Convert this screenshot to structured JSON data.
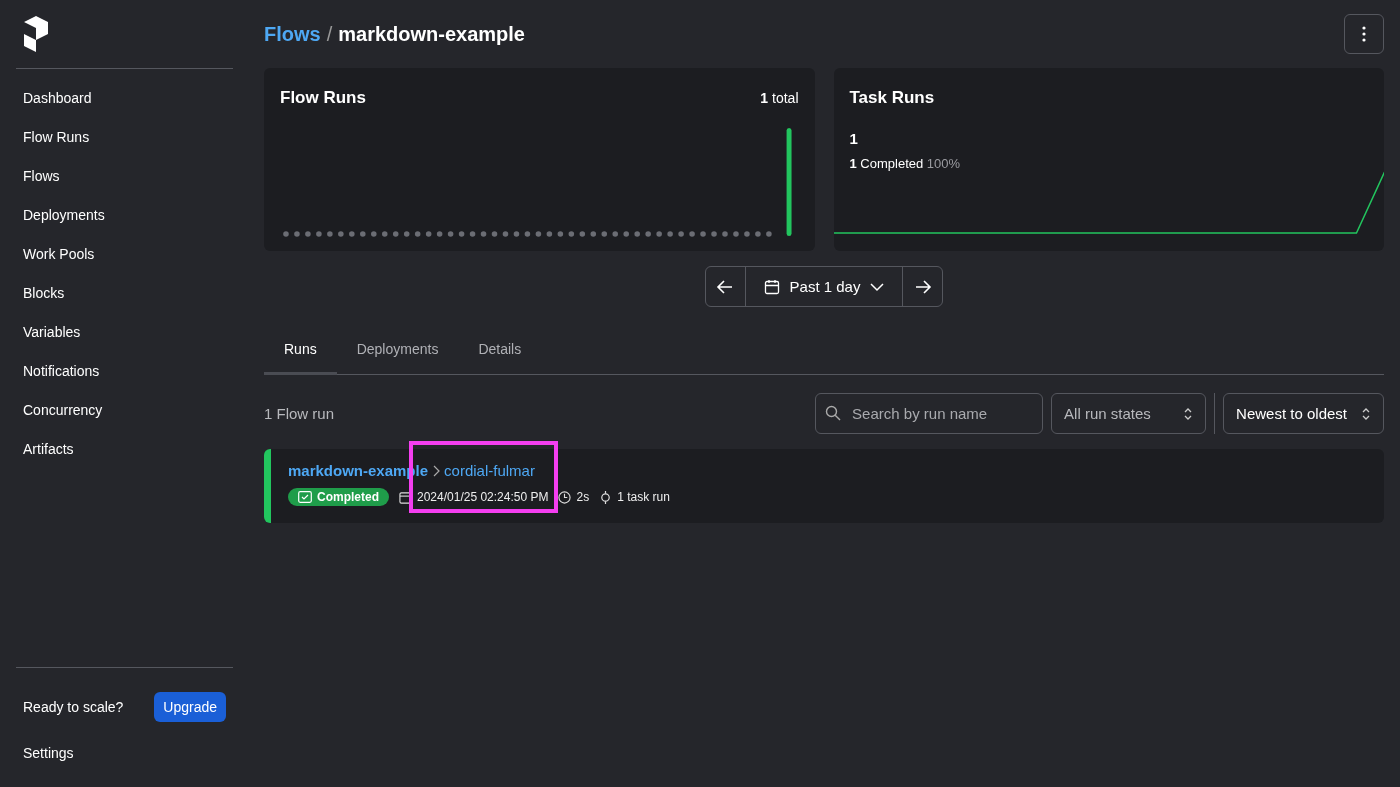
{
  "sidebar": {
    "items": [
      {
        "label": "Dashboard"
      },
      {
        "label": "Flow Runs"
      },
      {
        "label": "Flows"
      },
      {
        "label": "Deployments"
      },
      {
        "label": "Work Pools"
      },
      {
        "label": "Blocks"
      },
      {
        "label": "Variables"
      },
      {
        "label": "Notifications"
      },
      {
        "label": "Concurrency"
      },
      {
        "label": "Artifacts"
      }
    ],
    "prompt": "Ready to scale?",
    "upgrade": "Upgrade",
    "settings": "Settings"
  },
  "breadcrumb": {
    "parent": "Flows",
    "separator": "/",
    "current": "markdown-example"
  },
  "flow_runs_card": {
    "title": "Flow Runs",
    "total_count": "1",
    "total_label": "total"
  },
  "task_runs_card": {
    "title": "Task Runs",
    "count": "1",
    "completed_count": "1",
    "completed_label": "Completed",
    "percent": "100%"
  },
  "date_range": {
    "label": "Past 1 day"
  },
  "tabs": [
    {
      "label": "Runs",
      "selected": true
    },
    {
      "label": "Deployments",
      "selected": false
    },
    {
      "label": "Details",
      "selected": false
    }
  ],
  "runs_count": "1 Flow run",
  "search": {
    "placeholder": "Search by run name"
  },
  "state_filter": {
    "value": "All run states"
  },
  "sort": {
    "value": "Newest to oldest"
  },
  "runs": [
    {
      "flow": "markdown-example",
      "name": "cordial-fulmar",
      "state": "Completed",
      "kind": "completed",
      "color": "#22c55e",
      "time": "2024/01/25 02:24:50 PM",
      "duration": "2s",
      "task_runs": "1 task run",
      "highlighted": true
    }
  ]
}
